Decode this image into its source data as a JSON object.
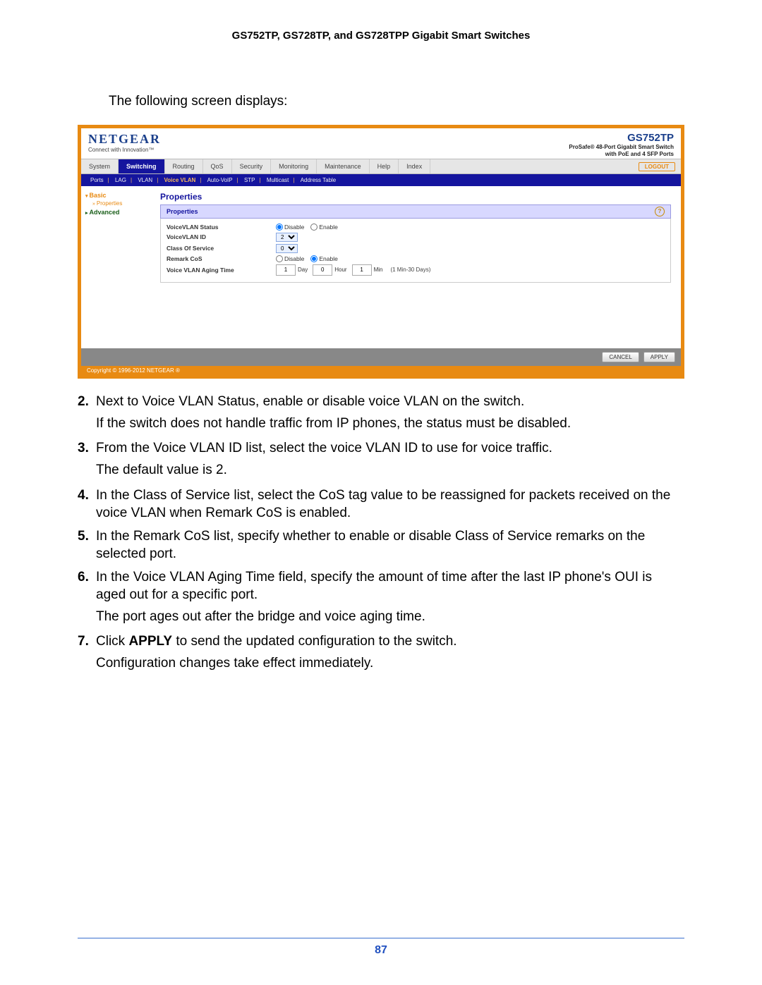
{
  "doc_header": "GS752TP, GS728TP, and GS728TPP Gigabit Smart Switches",
  "intro": "The following screen displays:",
  "page_number": "87",
  "screenshot": {
    "brand": "NETGEAR",
    "brand_tag": "Connect with Innovation™",
    "model": "GS752TP",
    "model_sub1": "ProSafe® 48-Port Gigabit Smart Switch",
    "model_sub2": "with PoE and 4 SFP Ports",
    "logout": "LOGOUT",
    "tabs": [
      "System",
      "Switching",
      "Routing",
      "QoS",
      "Security",
      "Monitoring",
      "Maintenance",
      "Help",
      "Index"
    ],
    "active_tab": "Switching",
    "subtabs": {
      "ports": "Ports",
      "lag": "LAG",
      "vlan": "VLAN",
      "voicevlan": "Voice VLAN",
      "autovoip": "Auto-VoIP",
      "stp": "STP",
      "multicast": "Multicast",
      "addrtable": "Address Table"
    },
    "sidebar": {
      "basic": "Basic",
      "properties": "Properties",
      "advanced": "Advanced"
    },
    "content": {
      "title": "Properties",
      "bar_title": "Properties",
      "rows": {
        "status_label": "VoiceVLAN Status",
        "disable": "Disable",
        "enable": "Enable",
        "vlanid_label": "VoiceVLAN ID",
        "vlanid_val": "2",
        "cos_label": "Class Of Service",
        "cos_val": "0",
        "remark_label": "Remark CoS",
        "aging_label": "Voice VLAN Aging Time",
        "day_val": "1",
        "day_unit": "Day",
        "hour_val": "0",
        "hour_unit": "Hour",
        "min_val": "1",
        "min_unit": "Min",
        "aging_hint": "(1 Min-30 Days)"
      }
    },
    "footer": {
      "cancel": "CANCEL",
      "apply": "APPLY"
    },
    "copyright": "Copyright © 1996-2012 NETGEAR ®"
  },
  "steps": {
    "s2n": "2.",
    "s2": "Next to Voice VLAN Status, enable or disable voice VLAN on the switch.",
    "s2c": "If the switch does not handle traffic from IP phones, the status must be disabled.",
    "s3n": "3.",
    "s3": "From the Voice VLAN ID list, select the voice VLAN ID to use for voice traffic.",
    "s3c": "The default value is 2.",
    "s4n": "4.",
    "s4": "In the Class of Service list, select the CoS tag value to be reassigned for packets received on the voice VLAN when Remark CoS is enabled.",
    "s5n": "5.",
    "s5": "In the Remark CoS list, specify whether to enable or disable Class of Service remarks on the selected port.",
    "s6n": "6.",
    "s6": "In the Voice VLAN Aging Time field, specify the amount of time after the last IP phone's OUI is aged out for a specific port.",
    "s6c": "The port ages out after the bridge and voice aging time.",
    "s7n": "7.",
    "s7a": "Click ",
    "s7b": "APPLY",
    "s7c": " to send the updated configuration to the switch.",
    "s7d": "Configuration changes take effect immediately."
  }
}
